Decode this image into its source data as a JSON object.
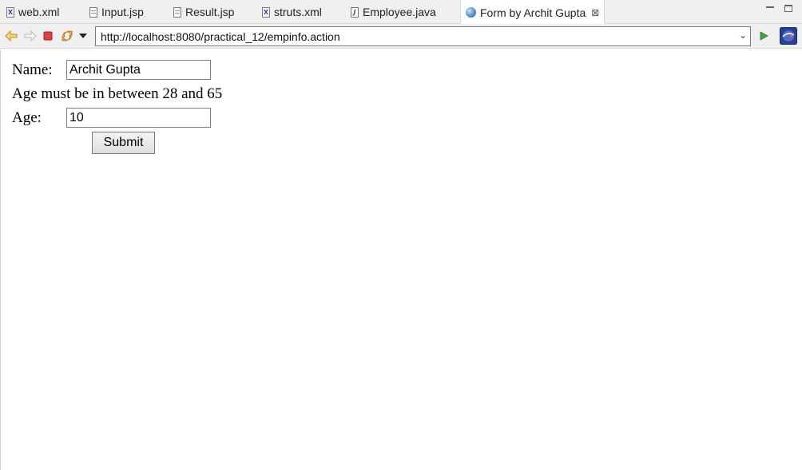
{
  "tabs": [
    {
      "label": "web.xml",
      "icon": "xml-file-icon"
    },
    {
      "label": "Input.jsp",
      "icon": "jsp-file-icon"
    },
    {
      "label": "Result.jsp",
      "icon": "jsp-file-icon"
    },
    {
      "label": "struts.xml",
      "icon": "xml-file-icon"
    },
    {
      "label": "Employee.java",
      "icon": "java-file-icon"
    },
    {
      "label": "Form by Archit Gupta",
      "icon": "globe-icon",
      "active": true
    }
  ],
  "toolbar": {
    "url": "http://localhost:8080/practical_12/empinfo.action"
  },
  "form": {
    "name_label": "Name:",
    "name_value": "Archit Gupta",
    "age_error": "Age must be in between 28 and 65",
    "age_label": "Age:",
    "age_value": "10",
    "submit_label": "Submit"
  },
  "colors": {
    "chrome_bg": "#f0f0f0",
    "stop_red": "#e04040",
    "go_green": "#3aa53a",
    "nav_orange": "#f0a020"
  }
}
